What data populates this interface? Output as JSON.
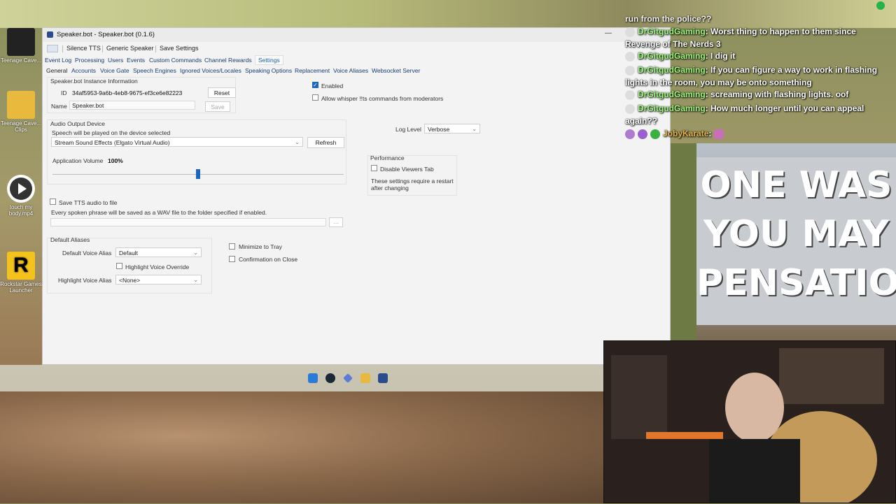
{
  "desktop": {
    "icons": [
      {
        "label": "Teenage Cave..."
      },
      {
        "label": "Teenage Cave... Clips"
      },
      {
        "label": "touch my body.mp4"
      },
      {
        "label": "Rockstar Games Launcher"
      }
    ]
  },
  "window": {
    "title": "Speaker.bot - Speaker.bot (0.1.6)",
    "minimize_glyph": "—"
  },
  "toolbar": {
    "silence_label": "Silence TTS",
    "generic_speaker_label": "Generic Speaker",
    "save_settings_label": "Save Settings"
  },
  "tabs": [
    "Event Log",
    "Processing",
    "Users",
    "Events",
    "Custom Commands",
    "Channel Rewards",
    "Settings"
  ],
  "subtabs": [
    "General",
    "Accounts",
    "Voice Gate",
    "Speech Engines",
    "Ignored Voices/Locales",
    "Speaking Options",
    "Replacement",
    "Voice Aliases",
    "Websocket Server"
  ],
  "instance": {
    "heading": "Speaker.bot Instance Information",
    "id_label": "ID",
    "id_value": "34af5953-9a6b-4eb8-9675-ef3ce6e82223",
    "reset_label": "Reset",
    "name_label": "Name",
    "name_value": "Speaker.bot",
    "save_label": "Save"
  },
  "enabled": {
    "label": "Enabled",
    "checked": true
  },
  "allow_whisper": {
    "label": "Allow whisper !!ts commands from moderators",
    "checked": false
  },
  "log_level": {
    "label": "Log Level",
    "value": "Verbose"
  },
  "audio_output": {
    "heading": "Audio Output Device",
    "description": "Speech will be played on the device selected",
    "device": "Stream Sound Effects (Elgato Virtual Audio)",
    "refresh_label": "Refresh",
    "volume_label": "Application Volume",
    "volume_value": "100%",
    "volume_fraction": 0.5
  },
  "performance": {
    "heading": "Performance",
    "disable_viewers_label": "Disable Viewers Tab",
    "note": "These settings require a restart after changing"
  },
  "save_tts": {
    "label": "Save TTS audio to file",
    "description": "Every spoken phrase will be saved as a WAV file to the folder specified if enabled.",
    "browse_label": "..."
  },
  "default_aliases": {
    "heading": "Default Aliases",
    "default_voice_label": "Default Voice Alias",
    "default_voice_value": "Default",
    "highlight_override_label": "Highlight Voice Override",
    "highlight_alias_label": "Highlight Voice Alias",
    "highlight_alias_value": "<None>"
  },
  "window_options": {
    "minimize_tray_label": "Minimize to Tray",
    "confirm_close_label": "Confirmation on Close"
  },
  "chat": [
    {
      "user": "DrGitgudGaming",
      "text": "Worst thing to happen to them since Revenge of The Nerds 3"
    },
    {
      "user": "DrGitgudGaming",
      "text": "I dig it"
    },
    {
      "user": "DrGitgudGaming",
      "text": "If you can figure a way to work in flashing lights in the room, you may be onto something"
    },
    {
      "user": "DrGitgudGaming",
      "text": "screaming with flashing lights. oof"
    },
    {
      "user": "DrGitgudGaming",
      "text": "How much longer until you can appeal again??"
    },
    {
      "user": "JobyKarate",
      "text": ""
    }
  ],
  "chat_partial_top": "run from the police??",
  "billboard": [
    "ONE WAS",
    "YOU MAY",
    "PENSATION"
  ],
  "colors": {
    "accent": "#1a66c0",
    "chat_user": "#9cf97a",
    "chat_joby": "#e6b34a"
  }
}
